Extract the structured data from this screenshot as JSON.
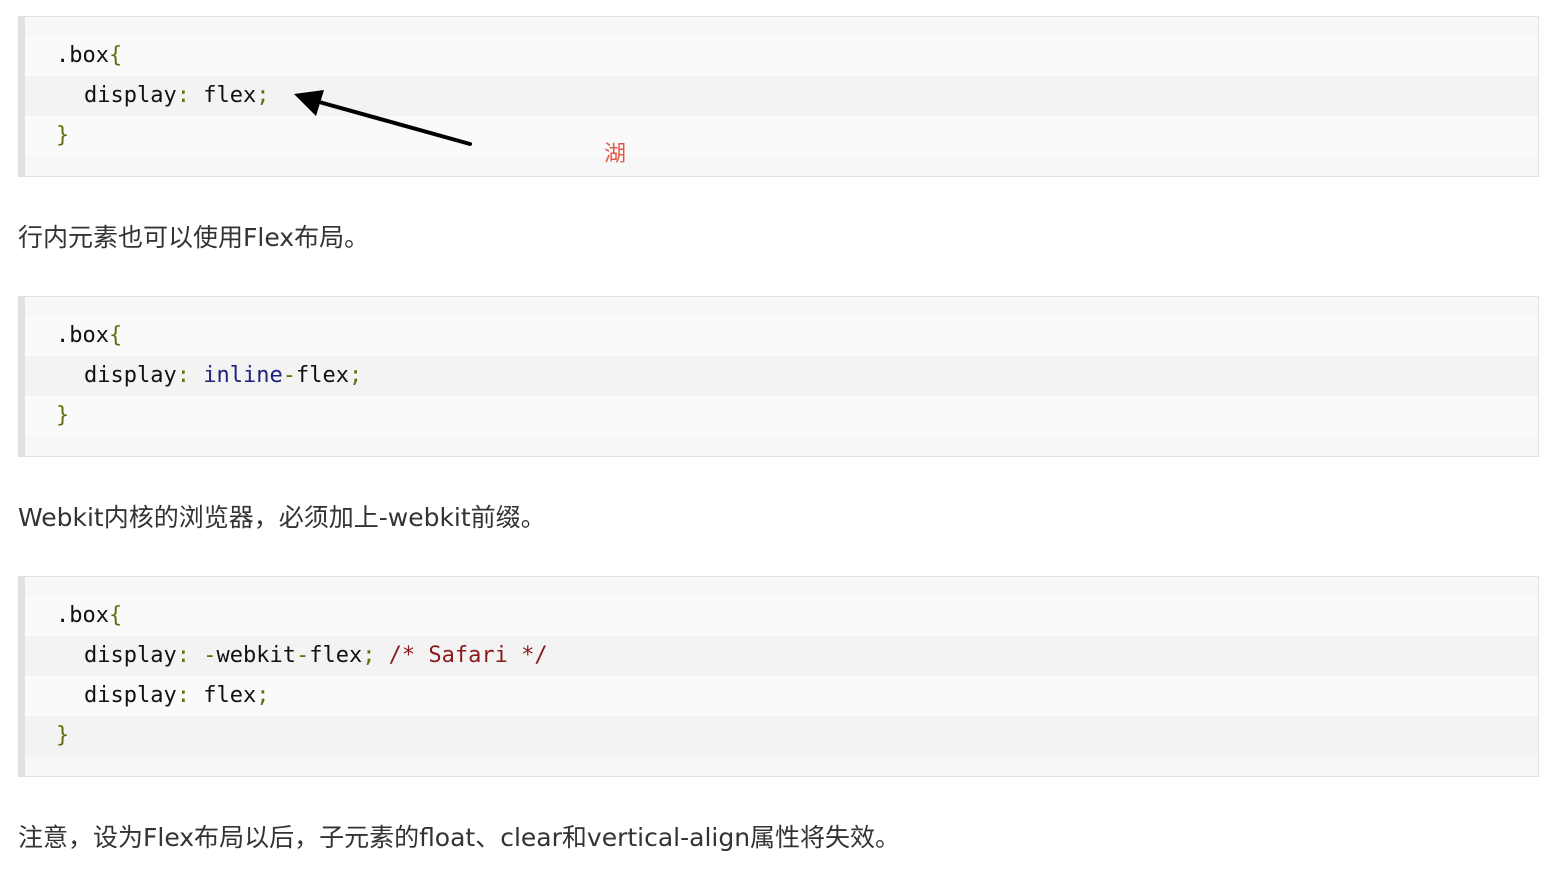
{
  "code_blocks": [
    {
      "lines": [
        {
          "indent": 0,
          "tokens": [
            {
              "t": ".box",
              "c": "plain"
            },
            {
              "t": "{",
              "c": "punct"
            }
          ]
        },
        {
          "indent": 1,
          "tokens": [
            {
              "t": "display",
              "c": "plain"
            },
            {
              "t": ":",
              "c": "punct"
            },
            {
              "t": " flex",
              "c": "plain"
            },
            {
              "t": ";",
              "c": "punct"
            }
          ]
        },
        {
          "indent": 0,
          "tokens": [
            {
              "t": "}",
              "c": "punct"
            }
          ]
        }
      ]
    },
    {
      "lines": [
        {
          "indent": 0,
          "tokens": [
            {
              "t": ".box",
              "c": "plain"
            },
            {
              "t": "{",
              "c": "punct"
            }
          ]
        },
        {
          "indent": 1,
          "tokens": [
            {
              "t": "display",
              "c": "plain"
            },
            {
              "t": ":",
              "c": "punct"
            },
            {
              "t": " ",
              "c": "plain"
            },
            {
              "t": "inline",
              "c": "kw"
            },
            {
              "t": "-",
              "c": "punct"
            },
            {
              "t": "flex",
              "c": "plain"
            },
            {
              "t": ";",
              "c": "punct"
            }
          ]
        },
        {
          "indent": 0,
          "tokens": [
            {
              "t": "}",
              "c": "punct"
            }
          ]
        }
      ]
    },
    {
      "lines": [
        {
          "indent": 0,
          "tokens": [
            {
              "t": ".box",
              "c": "plain"
            },
            {
              "t": "{",
              "c": "punct"
            }
          ]
        },
        {
          "indent": 1,
          "tokens": [
            {
              "t": "display",
              "c": "plain"
            },
            {
              "t": ":",
              "c": "punct"
            },
            {
              "t": " ",
              "c": "plain"
            },
            {
              "t": "-",
              "c": "punct"
            },
            {
              "t": "webkit",
              "c": "plain"
            },
            {
              "t": "-",
              "c": "punct"
            },
            {
              "t": "flex",
              "c": "plain"
            },
            {
              "t": ";",
              "c": "punct"
            },
            {
              "t": " /* Safari */",
              "c": "cmt"
            }
          ]
        },
        {
          "indent": 1,
          "tokens": [
            {
              "t": "display",
              "c": "plain"
            },
            {
              "t": ":",
              "c": "punct"
            },
            {
              "t": " flex",
              "c": "plain"
            },
            {
              "t": ";",
              "c": "punct"
            }
          ]
        },
        {
          "indent": 0,
          "tokens": [
            {
              "t": "}",
              "c": "punct"
            }
          ]
        }
      ]
    }
  ],
  "paragraphs": {
    "p1": "行内元素也可以使用Flex布局。",
    "p2": "Webkit内核的浏览器，必须加上-webkit前缀。",
    "p3": "注意，设为Flex布局以后，子元素的float、clear和vertical-align属性将失效。"
  },
  "watermark": "湖",
  "colors": {
    "punct": "#6b6b10",
    "keyword": "#1a237e",
    "comment": "#8b1a1a",
    "watermark": "#e05a4a",
    "arrow": "#000000"
  },
  "icons": {
    "annotation": "arrow-icon"
  }
}
